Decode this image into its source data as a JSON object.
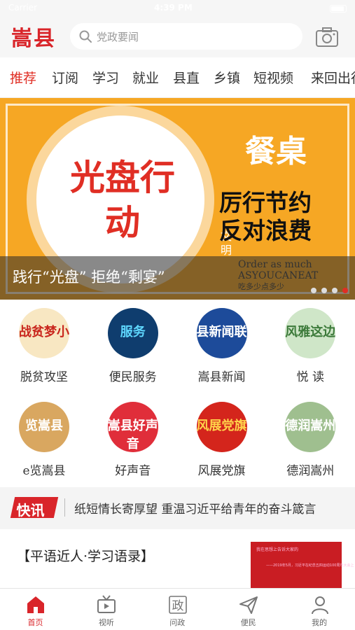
{
  "status_bar": {
    "carrier": "Carrier",
    "time": "4:39 PM"
  },
  "header": {
    "logo": "嵩县",
    "search_placeholder": "党政要闻",
    "camera_icon": "camera-icon"
  },
  "tabs": [
    "推荐",
    "订阅",
    "学习",
    "就业",
    "县直",
    "乡镇",
    "短视频",
    "来回出行"
  ],
  "active_tab": 0,
  "banner": {
    "plate_text": "光盘行动",
    "side_small": "文明",
    "side_big": "餐桌",
    "slogan_line1": "厉行节约",
    "slogan_line2": "反对浪费",
    "caption": "践行“光盘” 拒绝“剩宴”",
    "english_line1": "Order as much",
    "english_line2": "ASYOUCANEAT",
    "english_line3": "吃多少点多少",
    "slide_count": 4,
    "active_slide": 3,
    "bg_color": "#f6a724"
  },
  "grid": [
    {
      "label": "脱贫攻坚",
      "thumb_text": "战贫梦小",
      "bg": "#f8e7c2",
      "fg": "#c9271e"
    },
    {
      "label": "便民服务",
      "thumb_text": "服务",
      "bg": "#0f3d6e",
      "fg": "#5fd8ff"
    },
    {
      "label": "嵩县新闻",
      "thumb_text": "县新闻联",
      "bg": "#1d4b9a",
      "fg": "#ffffff"
    },
    {
      "label": "悦  读",
      "thumb_text": "风雅这边",
      "bg": "#cfe6c8",
      "fg": "#3c7a3a"
    },
    {
      "label": "e览嵩县",
      "thumb_text": "览嵩县",
      "bg": "#d9a760",
      "fg": "#ffffff"
    },
    {
      "label": "好声音",
      "thumb_text": "嵩县好声音",
      "bg": "#e02e3a",
      "fg": "#ffffff"
    },
    {
      "label": "风展党旗",
      "thumb_text": "风展党旗",
      "bg": "#d4251c",
      "fg": "#ffd34a"
    },
    {
      "label": "德润嵩州",
      "thumb_text": "德润嵩州",
      "bg": "#9fbf8f",
      "fg": "#ffffff"
    }
  ],
  "ticker": {
    "badge": "快讯",
    "headline": "纸短情长寄厚望 重温习近平给青年的奋斗箴言"
  },
  "article": {
    "title": "【平语近人·学习语录】",
    "thumb_line1": "我在思想上告诉大家的",
    "thumb_line2": "——2019年5月，习近平在纪念五四运动100周年大会上"
  },
  "bottom_nav": [
    {
      "label": "首页",
      "icon": "home-icon"
    },
    {
      "label": "视听",
      "icon": "tv-icon"
    },
    {
      "label": "问政",
      "icon": "policy-icon",
      "glyph": "政"
    },
    {
      "label": "便民",
      "icon": "send-icon"
    },
    {
      "label": "我的",
      "icon": "user-icon"
    }
  ],
  "active_nav": 0,
  "colors": {
    "brand_red": "#d9252a",
    "accent_red": "#e02e24"
  }
}
